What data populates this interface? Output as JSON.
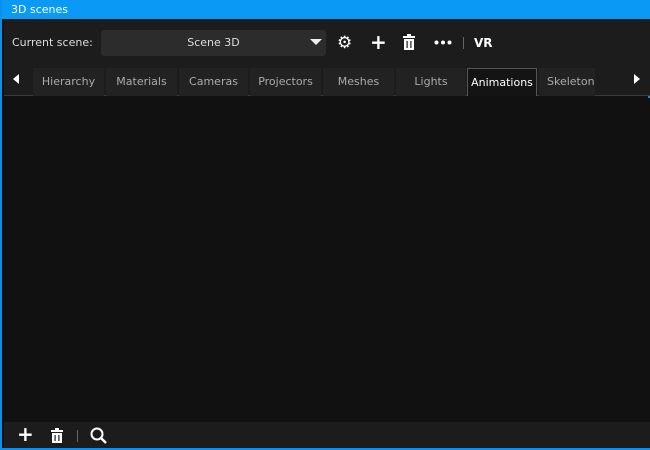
{
  "window": {
    "title": "3D scenes"
  },
  "toolbar": {
    "current_scene_label": "Current scene:",
    "scene_value": "Scene 3D",
    "vr_label": "VR",
    "icons": [
      "gear-icon",
      "plus-icon",
      "trash-icon",
      "more-icon"
    ]
  },
  "tabs": [
    {
      "label": "Hierarchy"
    },
    {
      "label": "Materials"
    },
    {
      "label": "Cameras"
    },
    {
      "label": "Projectors"
    },
    {
      "label": "Meshes"
    },
    {
      "label": "Lights"
    },
    {
      "label": "Animations",
      "selected": true
    },
    {
      "label": "Skeleton"
    }
  ],
  "bottom": {
    "icons": [
      "plus-icon",
      "trash-icon",
      "search-icon"
    ]
  },
  "colors": {
    "accent": "#0a9af5"
  }
}
